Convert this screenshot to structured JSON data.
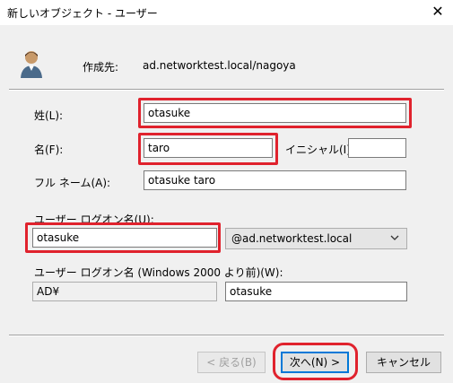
{
  "window": {
    "title": "新しいオブジェクト - ユーザー",
    "close_icon": "close-icon"
  },
  "header": {
    "create_in_label": "作成先:",
    "create_in_value": "ad.networktest.local/nagoya",
    "icon": "user-icon"
  },
  "form": {
    "last_name_label": "姓(L):",
    "last_name_value": "otasuke",
    "first_name_label": "名(F):",
    "first_name_value": "taro",
    "initials_label": "イニシャル(I):",
    "initials_value": "",
    "full_name_label": "フル ネーム(A):",
    "full_name_value": "otasuke taro",
    "logon_name_label": "ユーザー ログオン名(U):",
    "logon_name_value": "otasuke",
    "domain_suffix_value": "@ad.networktest.local",
    "pre2000_label": "ユーザー ログオン名 (Windows 2000 より前)(W):",
    "pre2000_domain_value": "AD¥",
    "pre2000_name_value": "otasuke"
  },
  "buttons": {
    "back": "< 戻る(B)",
    "next": "次へ(N) >",
    "cancel": "キャンセル"
  },
  "colors": {
    "highlight": "#e0222d",
    "dialog_bg": "#f0f0f0",
    "focus": "#0078d7"
  }
}
